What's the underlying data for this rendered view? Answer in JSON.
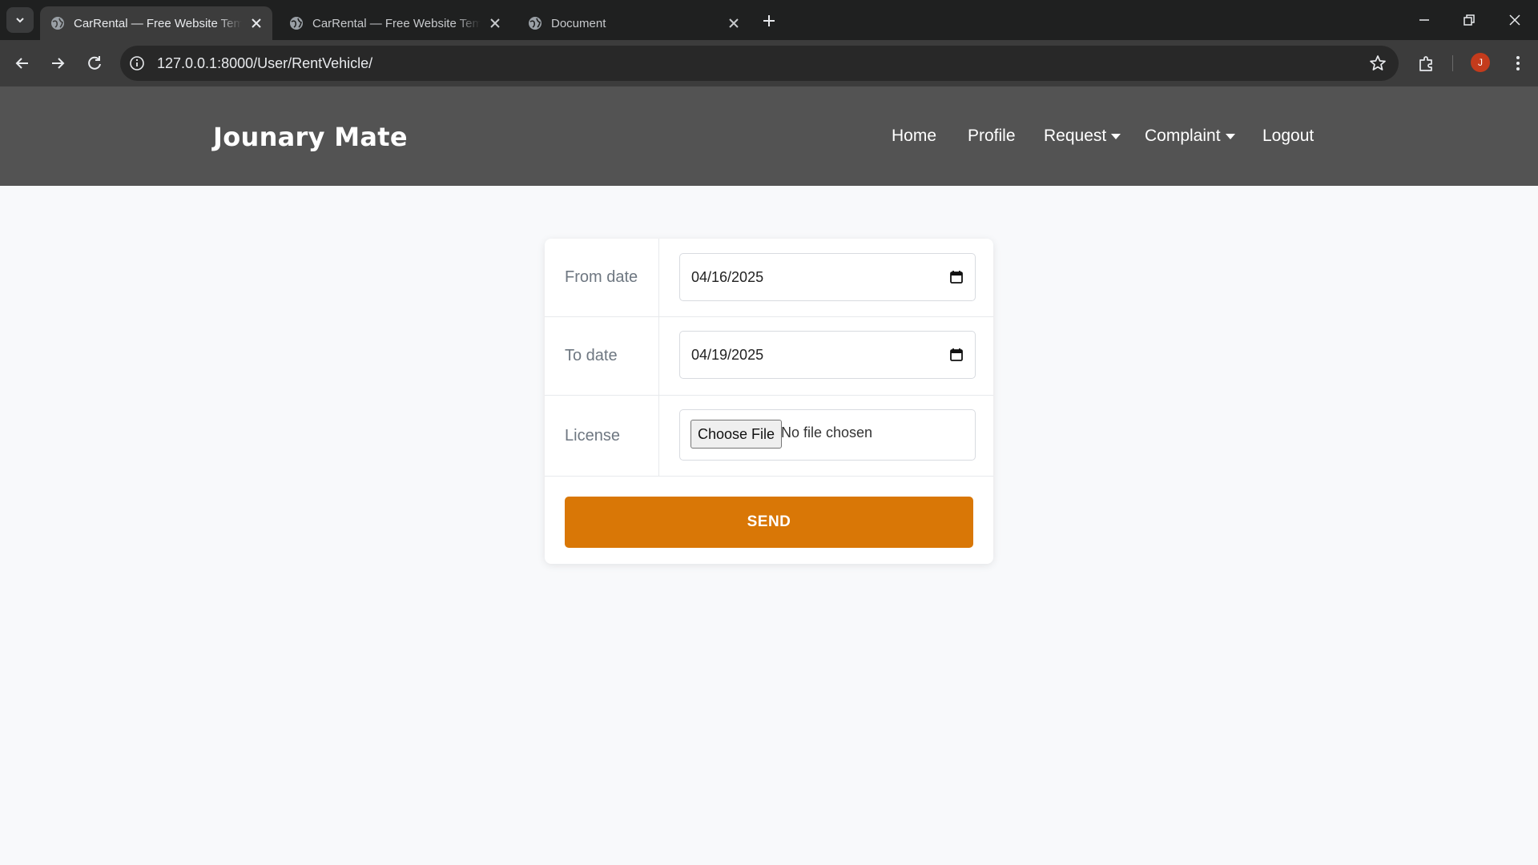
{
  "browser": {
    "tabs": [
      {
        "title": "CarRental — Free Website Temp",
        "active": true
      },
      {
        "title": "CarRental — Free Website Temp",
        "active": false
      },
      {
        "title": "Document",
        "active": false
      }
    ],
    "url": "127.0.0.1:8000/User/RentVehicle/",
    "profile_initial": "J",
    "profile_color": "#c43b1c"
  },
  "site": {
    "brand": "Jounary Mate",
    "nav": [
      {
        "label": "Home",
        "dropdown": false
      },
      {
        "label": "Profile",
        "dropdown": false
      },
      {
        "label": "Request",
        "dropdown": true
      },
      {
        "label": "Complaint",
        "dropdown": true
      },
      {
        "label": "Logout",
        "dropdown": false
      }
    ]
  },
  "form": {
    "from_date": {
      "label": "From date",
      "value": "04/16/2025"
    },
    "to_date": {
      "label": "To date",
      "value": "04/19/2025"
    },
    "license": {
      "label": "License",
      "button": "Choose File",
      "status": "No file chosen"
    },
    "submit": "SEND"
  },
  "colors": {
    "header_bg": "#535353",
    "accent": "#d97706",
    "page_bg": "#f8f9fb"
  }
}
